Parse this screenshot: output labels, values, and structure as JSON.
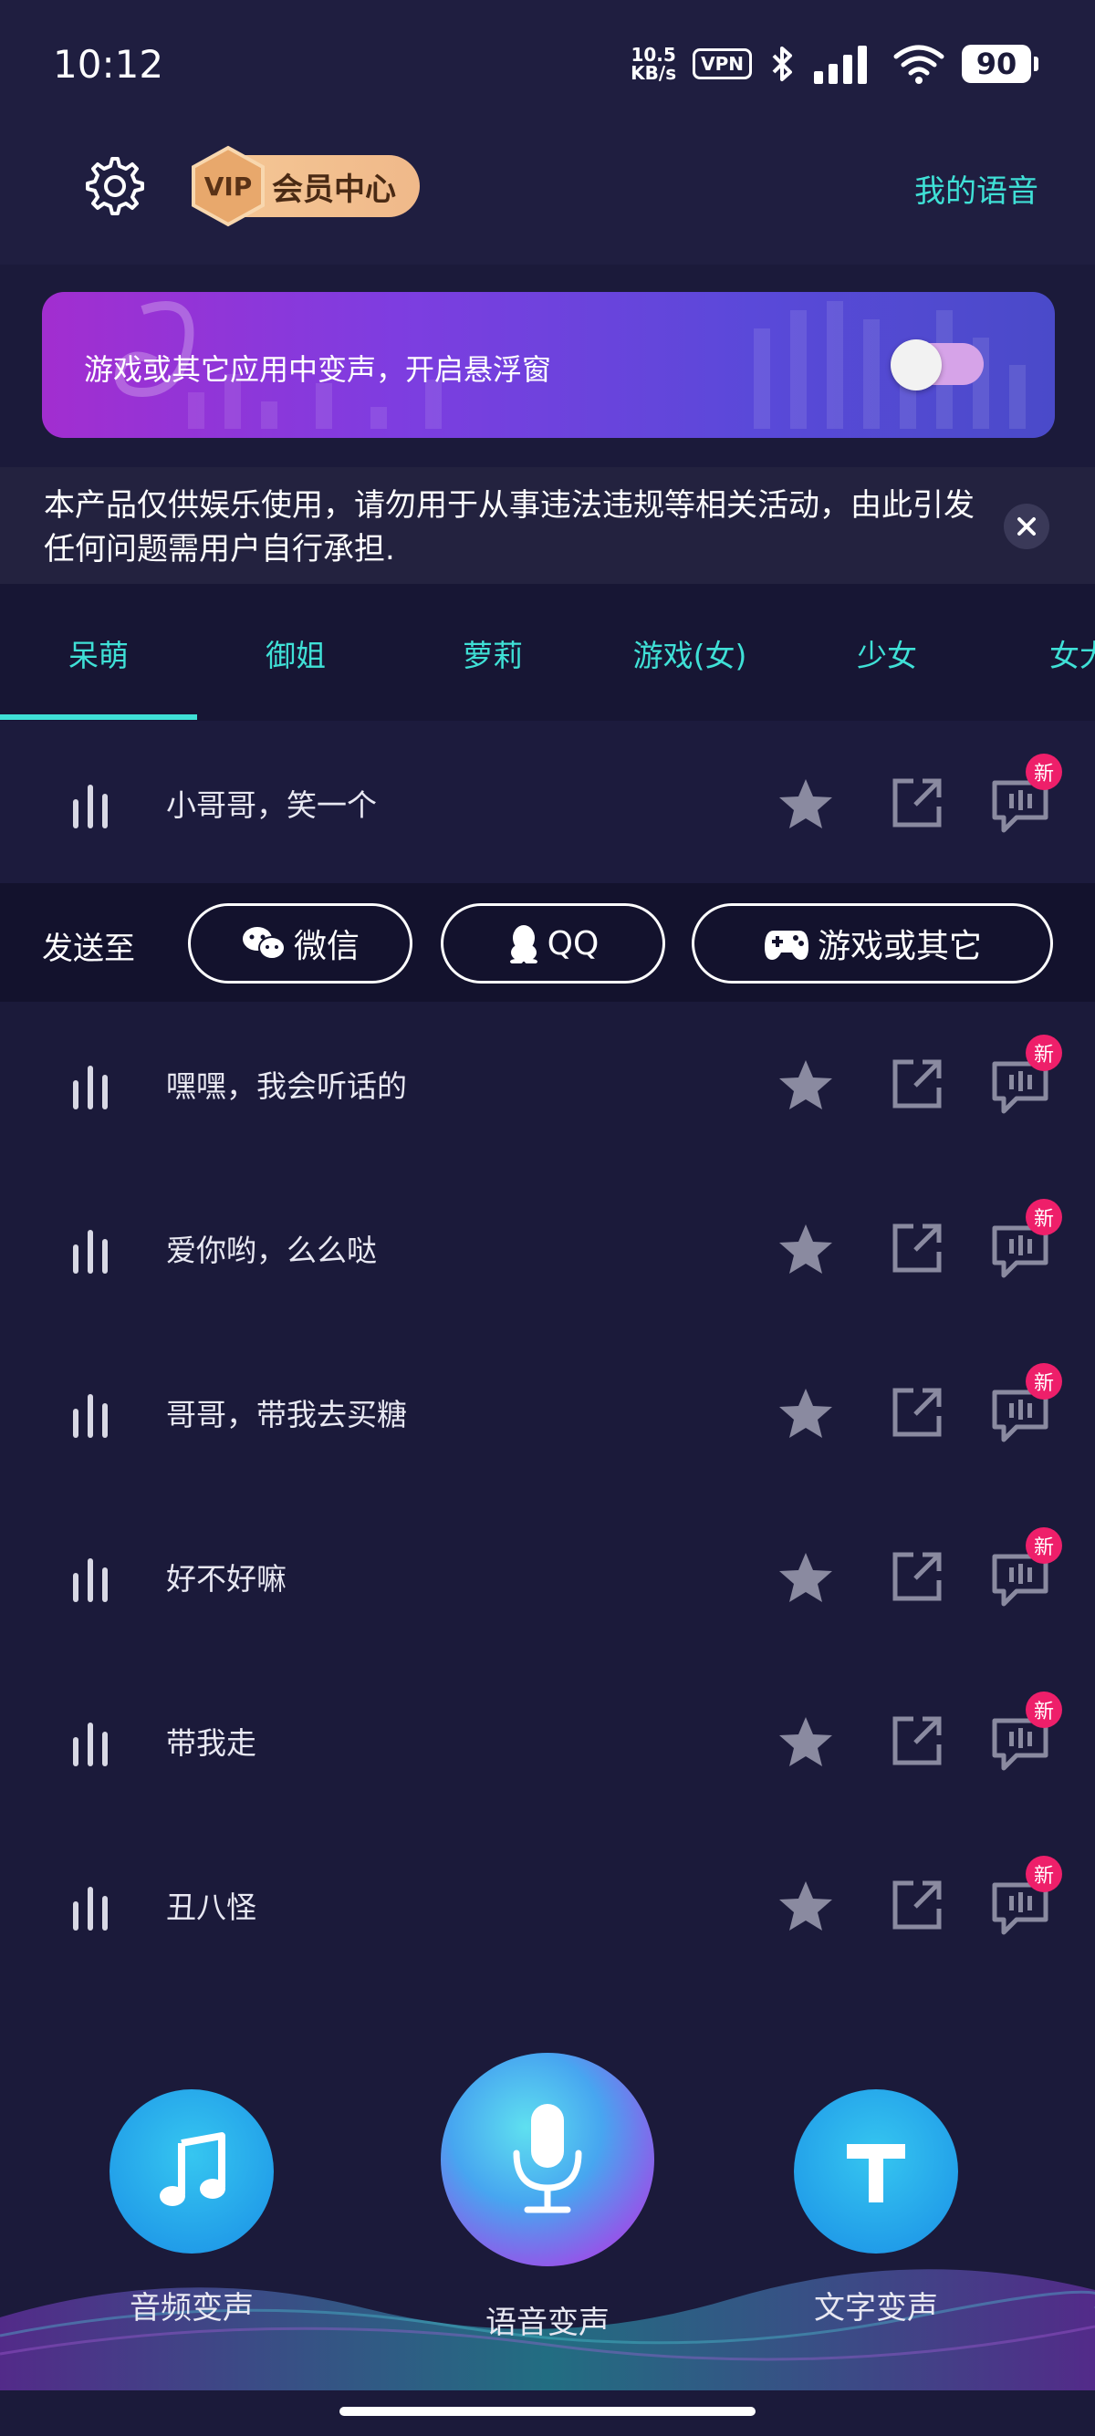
{
  "status": {
    "time": "10:12",
    "net_speed_value": "10.5",
    "net_speed_unit": "KB/s",
    "vpn": "VPN",
    "battery": "90"
  },
  "header": {
    "vip_badge": "VIP",
    "vip_label": "会员中心",
    "my_voice": "我的语音"
  },
  "banner": {
    "text": "游戏或其它应用中变声，开启悬浮窗",
    "toggle_on": false
  },
  "disclaimer": {
    "text": "本产品仅供娱乐使用，请勿用于从事违法违规等相关活动，由此引发任何问题需用户自行承担."
  },
  "tabs": [
    "呆萌",
    "御姐",
    "萝莉",
    "游戏(女)",
    "少女",
    "女大"
  ],
  "active_tab": 0,
  "send_bar": {
    "label": "发送至",
    "wechat": "微信",
    "qq": "QQ",
    "games": "游戏或其它"
  },
  "voices": [
    {
      "label": "小哥哥，笑一个",
      "badge": "新"
    },
    {
      "label": "嘿嘿，我会听话的",
      "badge": "新"
    },
    {
      "label": "爱你哟，么么哒",
      "badge": "新"
    },
    {
      "label": "哥哥，带我去买糖",
      "badge": "新"
    },
    {
      "label": "好不好嘛",
      "badge": "新"
    },
    {
      "label": "带我走",
      "badge": "新"
    },
    {
      "label": "丑八怪",
      "badge": "新"
    }
  ],
  "bottom": {
    "audio": "音频变声",
    "voice": "语音变声",
    "text": "文字变声"
  },
  "colors": {
    "accent": "#3fe0d6",
    "background": "#1b1a3a",
    "badge": "#ee1f6a"
  }
}
